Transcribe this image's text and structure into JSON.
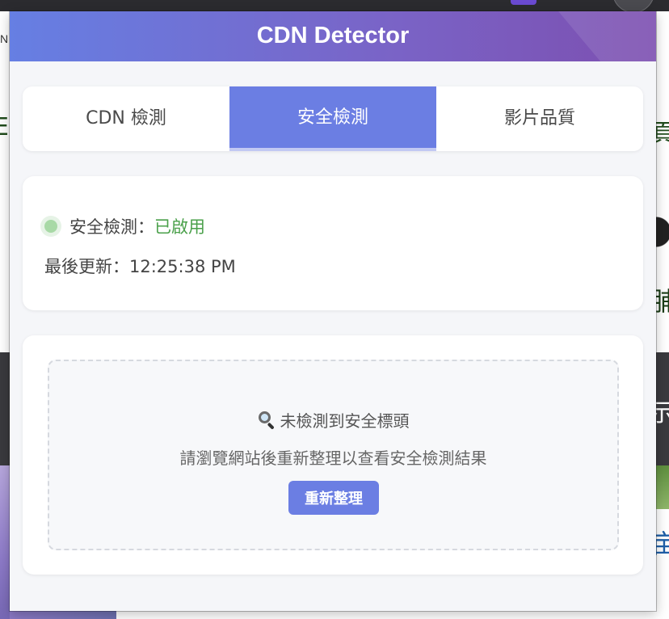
{
  "background": {
    "left_fragment": "N",
    "left_green_fragment": "E",
    "right_green_fragment": "頁",
    "right_green_fragment2": "脯",
    "right_white_fragment": "示",
    "right_blue_fragment": "亩"
  },
  "header": {
    "title": "CDN Detector"
  },
  "tabs": [
    {
      "label": "CDN 檢測",
      "active": false
    },
    {
      "label": "安全檢測",
      "active": true
    },
    {
      "label": "影片品質",
      "active": false
    }
  ],
  "status": {
    "label": "安全檢測：",
    "value": "已啟用",
    "update_label": "最後更新：12:25:38 PM"
  },
  "empty_state": {
    "icon": "search-icon",
    "title": "未檢測到安全標頭",
    "description": "請瀏覽網站後重新整理以查看安全檢測結果",
    "refresh_label": "重新整理"
  },
  "colors": {
    "accent": "#6b7ee3",
    "header_start": "#667fe3",
    "header_end": "#7c4fb0",
    "status_ok": "#4aa04a"
  }
}
